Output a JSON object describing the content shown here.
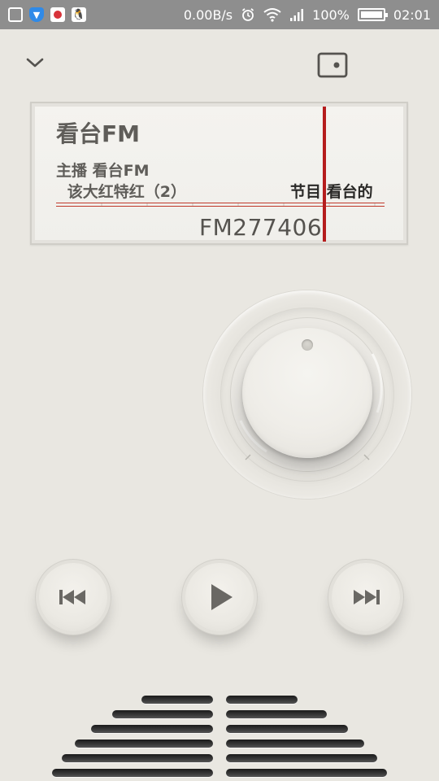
{
  "status_bar": {
    "qq_glyph": "🐧",
    "net_speed": "0.00B/s",
    "battery": "100%",
    "time": "02:01"
  },
  "display": {
    "station": "看台FM",
    "host": "主播 看台FM",
    "ticker_left": "该大红特红（2）",
    "ticker_right": "节目 看台的",
    "frequency": "FM277406"
  },
  "icons": {
    "collapse": "chevron-down-icon",
    "card": "card-icon",
    "prev": "skip-previous-icon",
    "play": "play-icon",
    "next": "skip-next-icon"
  },
  "colors": {
    "background": "#e9e7e1",
    "status_bar": "#8e8e8e",
    "needle": "#b51d1d",
    "text": "#5f5d59"
  }
}
